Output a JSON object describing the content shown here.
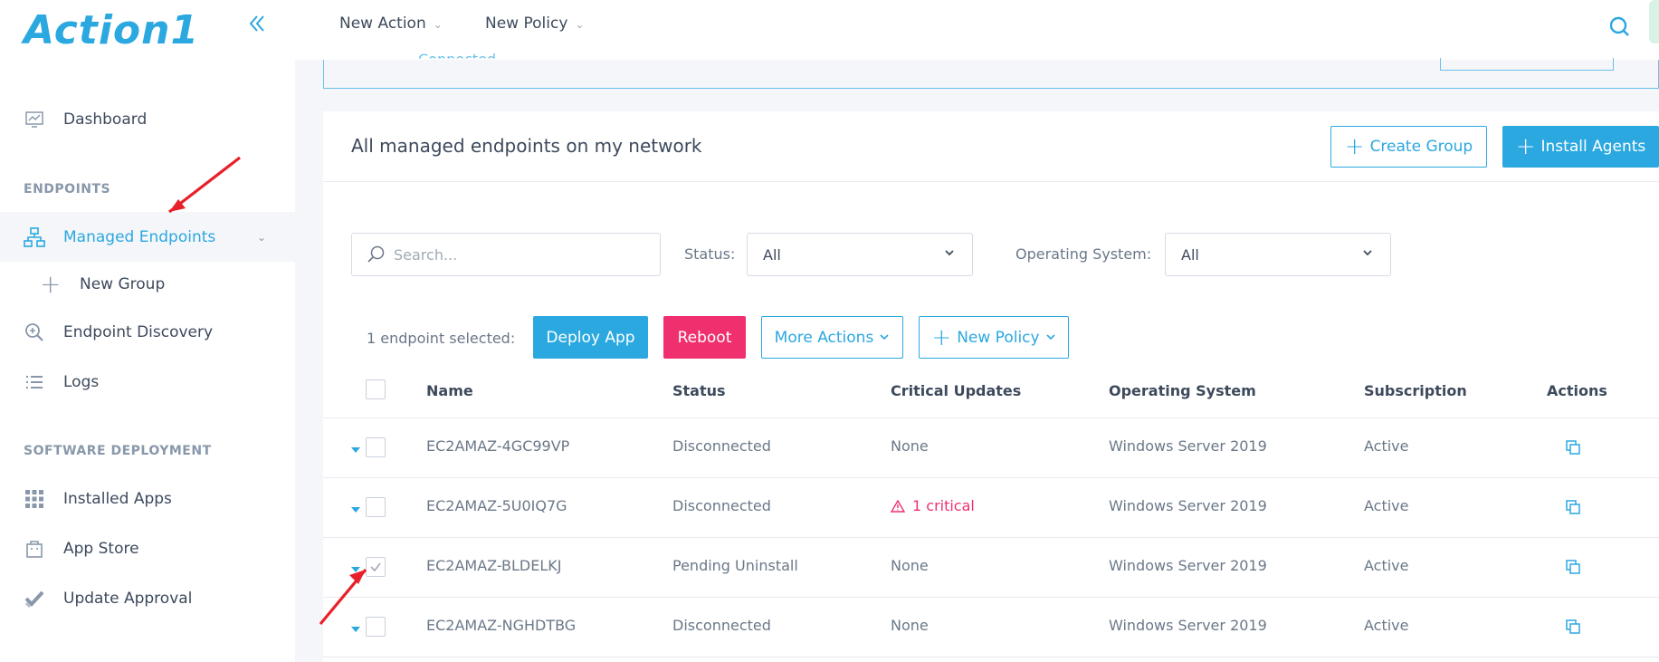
{
  "app": {
    "logo_text": "Action1",
    "collapse_icon": "double-chevron-left-icon"
  },
  "sidebar": {
    "dashboard": "Dashboard",
    "section_endpoints": "ENDPOINTS",
    "managed_endpoints": "Managed Endpoints",
    "new_group": "New Group",
    "endpoint_discovery": "Endpoint Discovery",
    "logs": "Logs",
    "section_software": "SOFTWARE DEPLOYMENT",
    "installed_apps": "Installed Apps",
    "app_store": "App Store",
    "update_approval": "Update Approval"
  },
  "topbar": {
    "new_action": "New Action",
    "new_policy": "New Policy"
  },
  "prev_panel": {
    "text": "Connected"
  },
  "card": {
    "title": "All managed endpoints on my network",
    "create_group": "Create Group",
    "install_agents": "Install Agents"
  },
  "filters": {
    "search_placeholder": "Search...",
    "status_label": "Status:",
    "status_value": "All",
    "os_label": "Operating System:",
    "os_value": "All"
  },
  "bulk": {
    "selected_text": "1 endpoint selected:",
    "deploy_app": "Deploy App",
    "reboot": "Reboot",
    "more_actions": "More Actions",
    "new_policy": "New Policy"
  },
  "table": {
    "headers": [
      "Name",
      "Status",
      "Critical Updates",
      "Operating System",
      "Subscription",
      "Actions"
    ],
    "rows": [
      {
        "name": "EC2AMAZ-4GC99VP",
        "status": "Disconnected",
        "critical": "None",
        "critical_flag": false,
        "os": "Windows Server 2019",
        "subscription": "Active",
        "checked": false
      },
      {
        "name": "EC2AMAZ-5U0IQ7G",
        "status": "Disconnected",
        "critical": "1 critical",
        "critical_flag": true,
        "os": "Windows Server 2019",
        "subscription": "Active",
        "checked": false
      },
      {
        "name": "EC2AMAZ-BLDELKJ",
        "status": "Pending Uninstall",
        "critical": "None",
        "critical_flag": false,
        "os": "Windows Server 2019",
        "subscription": "Active",
        "checked": true
      },
      {
        "name": "EC2AMAZ-NGHDTBG",
        "status": "Disconnected",
        "critical": "None",
        "critical_flag": false,
        "os": "Windows Server 2019",
        "subscription": "Active",
        "checked": false
      }
    ]
  },
  "colors": {
    "accent": "#2ba8e0",
    "danger": "#f0306e",
    "annotation_arrow": "#e8202a"
  }
}
